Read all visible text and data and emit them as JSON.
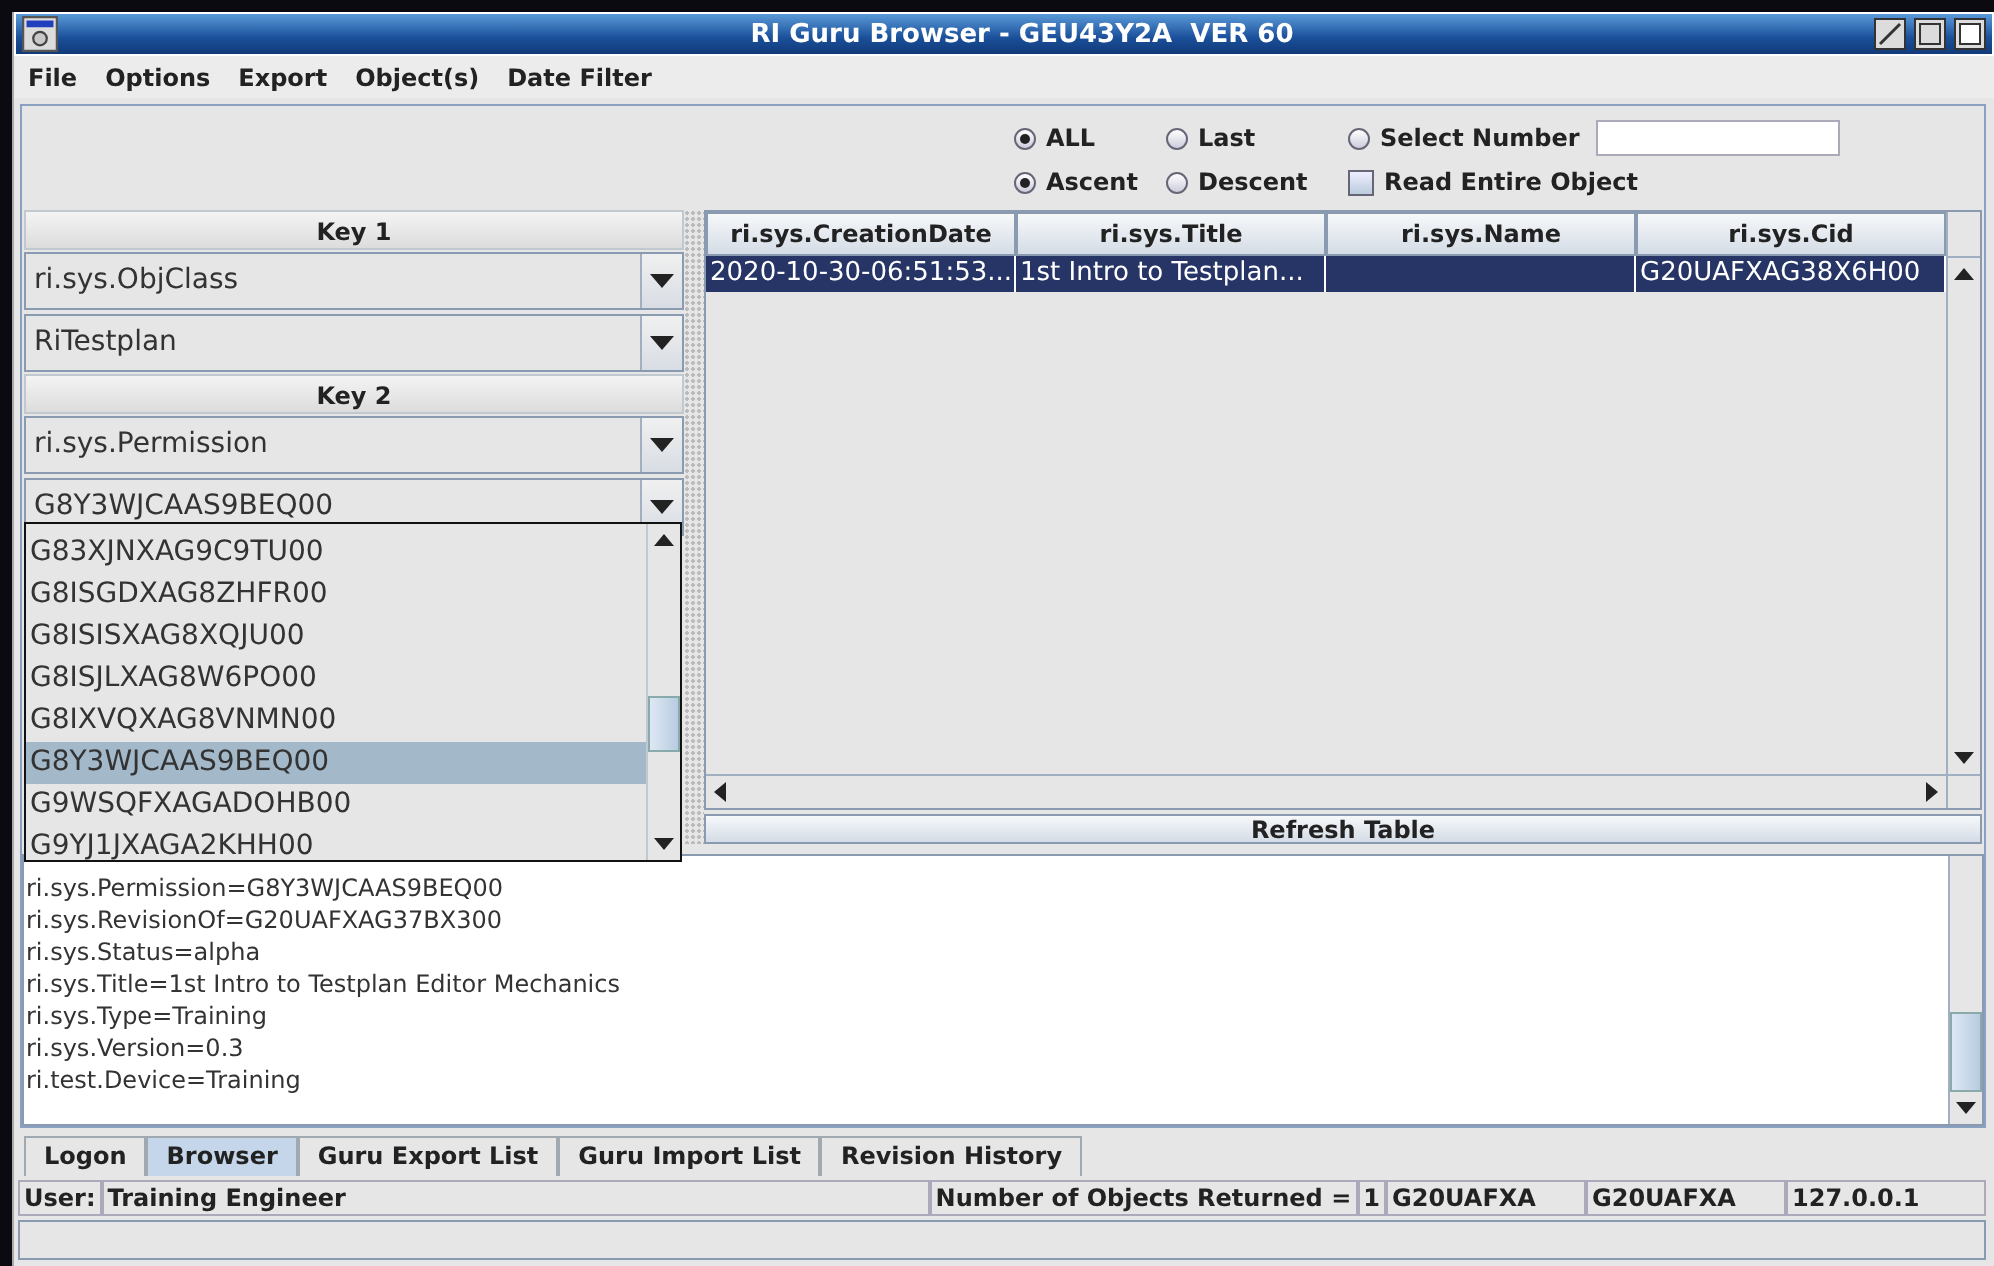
{
  "window": {
    "title": "RI Guru Browser - GEU43Y2A  VER 60"
  },
  "menu": [
    "File",
    "Options",
    "Export",
    "Object(s)",
    "Date Filter"
  ],
  "options": {
    "scope": [
      {
        "label": "ALL",
        "selected": true
      },
      {
        "label": "Last",
        "selected": false
      },
      {
        "label": "Select Number",
        "selected": false
      }
    ],
    "order": [
      {
        "label": "Ascent",
        "selected": true
      },
      {
        "label": "Descent",
        "selected": false
      }
    ],
    "read_entire_object": {
      "label": "Read Entire Object",
      "checked": false
    }
  },
  "keys": [
    {
      "label": "Key 1",
      "combos": [
        "ri.sys.ObjClass",
        "RiTestplan"
      ]
    },
    {
      "label": "Key 2",
      "combos": [
        "ri.sys.Permission",
        "G8Y3WJCAAS9BEQ00"
      ]
    }
  ],
  "dropdown": {
    "items": [
      {
        "label": "G83XJNXAG9C9TU00",
        "selected": false
      },
      {
        "label": "G8ISGDXAG8ZHFR00",
        "selected": false
      },
      {
        "label": "G8ISISXAG8XQJU00",
        "selected": false
      },
      {
        "label": "G8ISJLXAG8W6PO00",
        "selected": false
      },
      {
        "label": "G8IXVQXAG8VNMN00",
        "selected": false
      },
      {
        "label": "G8Y3WJCAAS9BEQ00",
        "selected": true
      },
      {
        "label": "G9WSQFXAGADOHB00",
        "selected": false
      },
      {
        "label": "G9YJ1JXAGA2KHH00",
        "selected": false
      }
    ]
  },
  "table": {
    "columns": [
      "ri.sys.CreationDate",
      "ri.sys.Title",
      "ri.sys.Name",
      "ri.sys.Cid"
    ],
    "rows": [
      {
        "selected": true,
        "cells": [
          "2020-10-30-06:51:53....",
          "1st Intro to Testplan...",
          "",
          "G20UAFXAG38X6H00"
        ]
      }
    ]
  },
  "refresh_button": "Refresh Table",
  "details": [
    "ri.sys.Permission=G8Y3WJCAAS9BEQ00",
    "ri.sys.RevisionOf=G20UAFXAG37BX300",
    "ri.sys.Status=alpha",
    "ri.sys.Title=1st Intro to Testplan Editor Mechanics",
    "ri.sys.Type=Training",
    "ri.sys.Version=0.3",
    "ri.test.Device=Training"
  ],
  "tabs": [
    {
      "label": "Logon",
      "selected": false
    },
    {
      "label": "Browser",
      "selected": true
    },
    {
      "label": "Guru Export List",
      "selected": false
    },
    {
      "label": "Guru Import List",
      "selected": false
    },
    {
      "label": "Revision History",
      "selected": false
    }
  ],
  "status_bar": {
    "user_label": "User:",
    "user": "Training Engineer",
    "count_label": "Number of Objects Returned =",
    "count": "1",
    "fields": [
      "G20UAFXA",
      "G20UAFXA",
      "127.0.0.1"
    ]
  }
}
